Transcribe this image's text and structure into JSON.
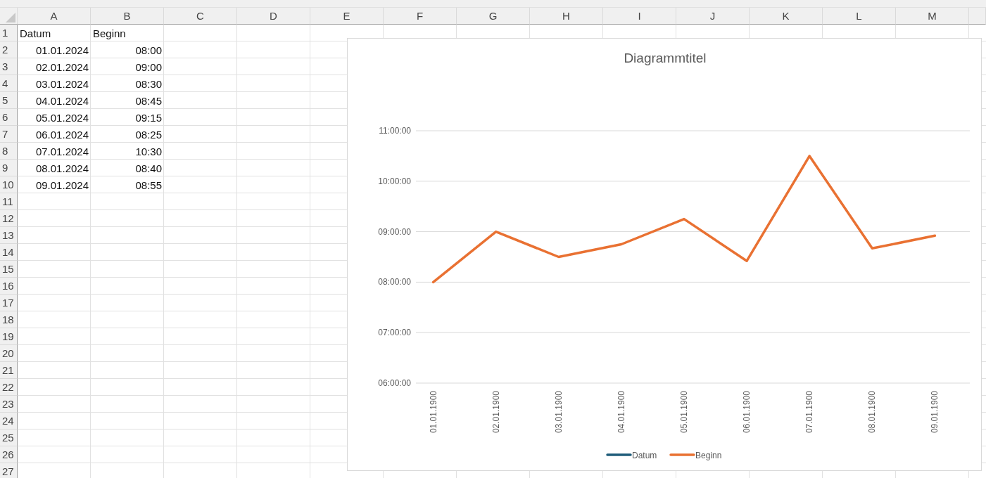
{
  "sheet": {
    "columns": [
      "A",
      "B",
      "C",
      "D",
      "E",
      "F",
      "G",
      "H",
      "I",
      "J",
      "K",
      "L",
      "M"
    ],
    "rows": [
      {
        "number": "1",
        "cells": [
          {
            "text": "Datum",
            "kind": "text"
          },
          {
            "text": "Beginn",
            "kind": "text"
          }
        ]
      },
      {
        "number": "2",
        "cells": [
          {
            "text": "01.01.2024",
            "kind": "number"
          },
          {
            "text": "08:00",
            "kind": "number"
          }
        ]
      },
      {
        "number": "3",
        "cells": [
          {
            "text": "02.01.2024",
            "kind": "number"
          },
          {
            "text": "09:00",
            "kind": "number"
          }
        ]
      },
      {
        "number": "4",
        "cells": [
          {
            "text": "03.01.2024",
            "kind": "number"
          },
          {
            "text": "08:30",
            "kind": "number"
          }
        ]
      },
      {
        "number": "5",
        "cells": [
          {
            "text": "04.01.2024",
            "kind": "number"
          },
          {
            "text": "08:45",
            "kind": "number"
          }
        ]
      },
      {
        "number": "6",
        "cells": [
          {
            "text": "05.01.2024",
            "kind": "number"
          },
          {
            "text": "09:15",
            "kind": "number"
          }
        ]
      },
      {
        "number": "7",
        "cells": [
          {
            "text": "06.01.2024",
            "kind": "number"
          },
          {
            "text": "08:25",
            "kind": "number"
          }
        ]
      },
      {
        "number": "8",
        "cells": [
          {
            "text": "07.01.2024",
            "kind": "number"
          },
          {
            "text": "10:30",
            "kind": "number"
          }
        ]
      },
      {
        "number": "9",
        "cells": [
          {
            "text": "08.01.2024",
            "kind": "number"
          },
          {
            "text": "08:40",
            "kind": "number"
          }
        ]
      },
      {
        "number": "10",
        "cells": [
          {
            "text": "09.01.2024",
            "kind": "number"
          },
          {
            "text": "08:55",
            "kind": "number"
          }
        ]
      },
      {
        "number": "11",
        "cells": []
      },
      {
        "number": "12",
        "cells": []
      },
      {
        "number": "13",
        "cells": []
      },
      {
        "number": "14",
        "cells": []
      },
      {
        "number": "15",
        "cells": []
      },
      {
        "number": "16",
        "cells": []
      },
      {
        "number": "17",
        "cells": []
      },
      {
        "number": "18",
        "cells": []
      },
      {
        "number": "19",
        "cells": []
      },
      {
        "number": "20",
        "cells": []
      },
      {
        "number": "21",
        "cells": []
      },
      {
        "number": "22",
        "cells": []
      },
      {
        "number": "23",
        "cells": []
      },
      {
        "number": "24",
        "cells": []
      },
      {
        "number": "25",
        "cells": []
      },
      {
        "number": "26",
        "cells": []
      },
      {
        "number": "27",
        "cells": []
      }
    ]
  },
  "chart": {
    "chart_data": {
      "type": "line",
      "title": "Diagrammtitel",
      "categories": [
        "01.01.1900",
        "02.01.1900",
        "03.01.1900",
        "04.01.1900",
        "05.01.1900",
        "06.01.1900",
        "07.01.1900",
        "08.01.1900",
        "09.01.1900"
      ],
      "grid": true,
      "series": [
        {
          "name": "Datum",
          "color": "#1f5c7a",
          "values": [
            null,
            null,
            null,
            null,
            null,
            null,
            null,
            null,
            null
          ]
        },
        {
          "name": "Beginn",
          "color": "#e97132",
          "values": [
            8,
            9,
            8.5,
            8.75,
            9.25,
            8.42,
            10.5,
            8.67,
            8.92
          ]
        }
      ],
      "ylim": [
        6,
        11
      ],
      "yticks": [
        {
          "value": 6,
          "label": "06:00:00"
        },
        {
          "value": 7,
          "label": "07:00:00"
        },
        {
          "value": 8,
          "label": "08:00:00"
        },
        {
          "value": 9,
          "label": "09:00:00"
        },
        {
          "value": 10,
          "label": "10:00:00"
        },
        {
          "value": 11,
          "label": "11:00:00"
        }
      ]
    }
  }
}
